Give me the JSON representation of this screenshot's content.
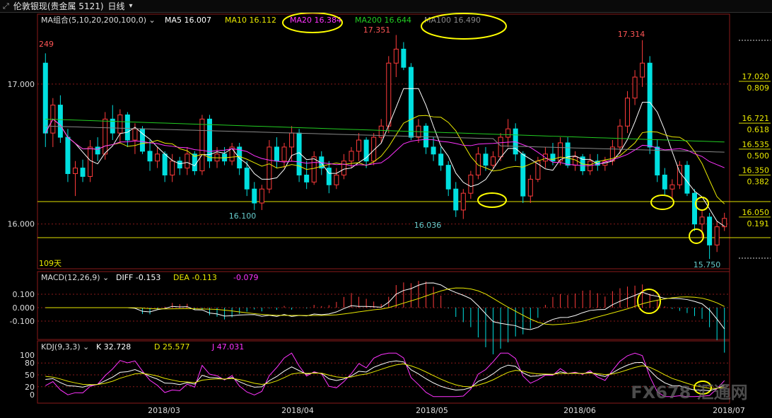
{
  "header": {
    "icon": "expand-icon",
    "symbol": "伦敦银现(贵金属 5121)",
    "period": "日线",
    "period_icon": "chevron-down-icon"
  },
  "chart_data": {
    "type": "candlestick",
    "title": "伦敦银现(贵金属 5121)",
    "price_axis": {
      "ticks": [
        17.0,
        16.0
      ],
      "ylim": [
        15.7,
        17.4
      ]
    },
    "ma_legend": {
      "label": "MA组合(5,10,20,200,100,0)",
      "items": [
        {
          "name": "MA5",
          "value": "16.007",
          "color": "#ffffff"
        },
        {
          "name": "MA10",
          "value": "16.112",
          "color": "#e8e800"
        },
        {
          "name": "MA20",
          "value": "16.384",
          "color": "#ff33ff"
        },
        {
          "name": "MA200",
          "value": "16.644",
          "color": "#22cc22"
        },
        {
          "name": "MA100",
          "value": "16.490",
          "color": "#888888"
        }
      ]
    },
    "annotations": {
      "high1": "17.351",
      "high2": "17.314",
      "low1": "16.100",
      "low2": "16.036",
      "low3": "15.750",
      "left_value": "249",
      "bars_label": "109天"
    },
    "fib_levels": [
      {
        "price": "17.020",
        "ratio": "0.809"
      },
      {
        "price": "16.721",
        "ratio": "0.618"
      },
      {
        "price": "16.535",
        "ratio": "0.500"
      },
      {
        "price": "16.350",
        "ratio": "0.382"
      },
      {
        "price": "16.050",
        "ratio": "0.191"
      }
    ],
    "candles": [
      [
        17.15,
        17.22,
        16.55,
        16.65
      ],
      [
        16.65,
        16.9,
        16.55,
        16.85
      ],
      [
        16.85,
        16.92,
        16.58,
        16.62
      ],
      [
        16.62,
        16.68,
        16.3,
        16.36
      ],
      [
        16.36,
        16.45,
        16.2,
        16.4
      ],
      [
        16.4,
        16.46,
        16.3,
        16.34
      ],
      [
        16.34,
        16.6,
        16.3,
        16.55
      ],
      [
        16.55,
        16.62,
        16.45,
        16.5
      ],
      [
        16.5,
        16.8,
        16.46,
        16.75
      ],
      [
        16.75,
        16.85,
        16.6,
        16.65
      ],
      [
        16.65,
        16.82,
        16.58,
        16.78
      ],
      [
        16.78,
        16.8,
        16.55,
        16.6
      ],
      [
        16.6,
        16.72,
        16.5,
        16.68
      ],
      [
        16.68,
        16.7,
        16.5,
        16.52
      ],
      [
        16.52,
        16.6,
        16.38,
        16.45
      ],
      [
        16.45,
        16.55,
        16.4,
        16.5
      ],
      [
        16.5,
        16.52,
        16.3,
        16.35
      ],
      [
        16.35,
        16.5,
        16.3,
        16.45
      ],
      [
        16.45,
        16.48,
        16.35,
        16.4
      ],
      [
        16.4,
        16.55,
        16.35,
        16.5
      ],
      [
        16.5,
        16.52,
        16.35,
        16.38
      ],
      [
        16.38,
        16.78,
        16.35,
        16.75
      ],
      [
        16.75,
        16.78,
        16.4,
        16.45
      ],
      [
        16.45,
        16.55,
        16.4,
        16.5
      ],
      [
        16.5,
        16.55,
        16.42,
        16.45
      ],
      [
        16.45,
        16.58,
        16.42,
        16.55
      ],
      [
        16.55,
        16.58,
        16.35,
        16.4
      ],
      [
        16.4,
        16.45,
        16.2,
        16.25
      ],
      [
        16.25,
        16.3,
        16.1,
        16.15
      ],
      [
        16.15,
        16.28,
        16.1,
        16.25
      ],
      [
        16.25,
        16.6,
        16.22,
        16.55
      ],
      [
        16.55,
        16.62,
        16.4,
        16.45
      ],
      [
        16.45,
        16.58,
        16.4,
        16.55
      ],
      [
        16.55,
        16.7,
        16.45,
        16.65
      ],
      [
        16.65,
        16.68,
        16.3,
        16.35
      ],
      [
        16.35,
        16.45,
        16.25,
        16.3
      ],
      [
        16.3,
        16.52,
        16.28,
        16.48
      ],
      [
        16.48,
        16.52,
        16.35,
        16.4
      ],
      [
        16.4,
        16.45,
        16.22,
        16.28
      ],
      [
        16.28,
        16.4,
        16.25,
        16.35
      ],
      [
        16.35,
        16.5,
        16.32,
        16.45
      ],
      [
        16.45,
        16.55,
        16.4,
        16.52
      ],
      [
        16.52,
        16.65,
        16.45,
        16.6
      ],
      [
        16.6,
        16.62,
        16.4,
        16.45
      ],
      [
        16.45,
        16.65,
        16.42,
        16.62
      ],
      [
        16.62,
        16.75,
        16.58,
        16.7
      ],
      [
        16.7,
        17.2,
        16.65,
        17.15
      ],
      [
        17.15,
        17.351,
        17.05,
        17.25
      ],
      [
        17.25,
        17.3,
        17.1,
        17.12
      ],
      [
        17.12,
        17.15,
        16.6,
        16.62
      ],
      [
        16.62,
        16.75,
        16.58,
        16.7
      ],
      [
        16.7,
        16.72,
        16.5,
        16.55
      ],
      [
        16.55,
        16.62,
        16.45,
        16.5
      ],
      [
        16.5,
        16.55,
        16.38,
        16.42
      ],
      [
        16.42,
        16.45,
        16.2,
        16.25
      ],
      [
        16.25,
        16.3,
        16.05,
        16.1
      ],
      [
        16.1,
        16.25,
        16.036,
        16.22
      ],
      [
        16.22,
        16.38,
        16.18,
        16.35
      ],
      [
        16.35,
        16.55,
        16.32,
        16.5
      ],
      [
        16.5,
        16.55,
        16.38,
        16.42
      ],
      [
        16.42,
        16.52,
        16.4,
        16.48
      ],
      [
        16.48,
        16.65,
        16.45,
        16.62
      ],
      [
        16.62,
        16.75,
        16.55,
        16.68
      ],
      [
        16.68,
        16.72,
        16.45,
        16.5
      ],
      [
        16.5,
        16.52,
        16.15,
        16.2
      ],
      [
        16.2,
        16.35,
        16.15,
        16.32
      ],
      [
        16.32,
        16.48,
        16.3,
        16.45
      ],
      [
        16.45,
        16.55,
        16.4,
        16.5
      ],
      [
        16.5,
        16.58,
        16.42,
        16.45
      ],
      [
        16.45,
        16.62,
        16.42,
        16.58
      ],
      [
        16.58,
        16.62,
        16.4,
        16.42
      ],
      [
        16.42,
        16.52,
        16.38,
        16.48
      ],
      [
        16.48,
        16.5,
        16.35,
        16.38
      ],
      [
        16.38,
        16.5,
        16.35,
        16.45
      ],
      [
        16.45,
        16.5,
        16.38,
        16.42
      ],
      [
        16.42,
        16.48,
        16.38,
        16.45
      ],
      [
        16.45,
        16.6,
        16.42,
        16.55
      ],
      [
        16.55,
        16.75,
        16.5,
        16.7
      ],
      [
        16.7,
        16.95,
        16.65,
        16.9
      ],
      [
        16.9,
        17.1,
        16.85,
        17.05
      ],
      [
        17.05,
        17.314,
        16.98,
        17.15
      ],
      [
        17.15,
        17.2,
        16.5,
        16.55
      ],
      [
        16.55,
        16.6,
        16.3,
        16.35
      ],
      [
        16.35,
        16.4,
        16.2,
        16.25
      ],
      [
        16.25,
        16.32,
        16.18,
        16.28
      ],
      [
        16.28,
        16.45,
        16.25,
        16.42
      ],
      [
        16.42,
        16.45,
        16.2,
        16.22
      ],
      [
        16.22,
        16.25,
        15.95,
        16.0
      ],
      [
        16.0,
        16.1,
        15.9,
        16.05
      ],
      [
        16.05,
        16.08,
        15.75,
        15.85
      ],
      [
        15.85,
        16.02,
        15.8,
        15.98
      ],
      [
        15.98,
        16.08,
        15.95,
        16.04
      ]
    ],
    "macd": {
      "legend": "MACD(12,26,9)",
      "diff_label": "DIFF",
      "diff": "-0.153",
      "dea_label": "DEA",
      "dea": "-0.113",
      "macd": "-0.079",
      "ticks": [
        "0.100",
        "0.000",
        "-0.100"
      ]
    },
    "kdj": {
      "legend": "KDJ(9,3,3)",
      "k_label": "K",
      "k": "32.728",
      "d_label": "D",
      "d": "25.577",
      "j_label": "J",
      "j": "47.031",
      "ticks": [
        "100",
        "80",
        "50",
        "20",
        "0"
      ]
    },
    "x_labels": [
      "2018/03",
      "2018/04",
      "2018/05",
      "2018/06",
      "2018/07"
    ],
    "watermark": "FX678 汇通网"
  }
}
